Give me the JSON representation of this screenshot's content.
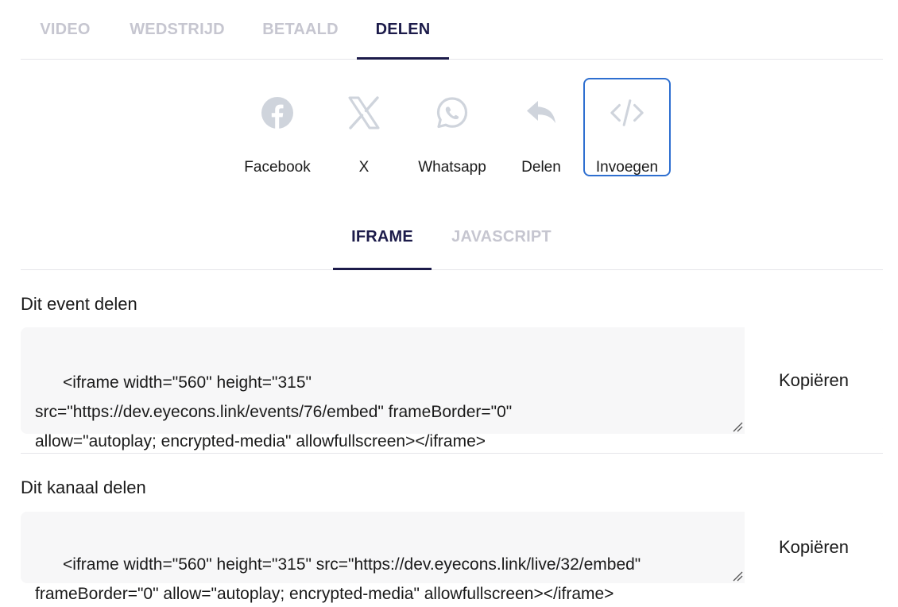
{
  "top_tabs": [
    {
      "label": "VIDEO",
      "active": false
    },
    {
      "label": "WEDSTRIJD",
      "active": false
    },
    {
      "label": "BETAALD",
      "active": false
    },
    {
      "label": "DELEN",
      "active": true
    }
  ],
  "share_options": [
    {
      "label": "Facebook",
      "icon": "facebook-icon",
      "selected": false
    },
    {
      "label": "X",
      "icon": "x-icon",
      "selected": false
    },
    {
      "label": "Whatsapp",
      "icon": "whatsapp-icon",
      "selected": false
    },
    {
      "label": "Delen",
      "icon": "reply-share-icon",
      "selected": false
    },
    {
      "label": "Invoegen",
      "icon": "code-embed-icon",
      "selected": true
    }
  ],
  "embed_tabs": [
    {
      "label": "IFRAME",
      "active": true
    },
    {
      "label": "JAVASCRIPT",
      "active": false
    }
  ],
  "sections": [
    {
      "title": "Dit event delen",
      "code": "<iframe width=\"560\" height=\"315\"\nsrc=\"https://dev.eyecons.link/events/76/embed\" frameBorder=\"0\"\nallow=\"autoplay; encrypted-media\" allowfullscreen></iframe>",
      "copy_label": "Kopiëren"
    },
    {
      "title": "Dit kanaal delen",
      "code": "<iframe width=\"560\" height=\"315\" src=\"https://dev.eyecons.link/live/32/embed\"\nframeBorder=\"0\" allow=\"autoplay; encrypted-media\" allowfullscreen></iframe>",
      "copy_label": "Kopiëren"
    }
  ],
  "colors": {
    "active_tab": "#1c1b4a",
    "inactive_tab": "#c6c6d0",
    "icon_gray": "#cfd4dc",
    "selected_border": "#2e6fd0"
  }
}
